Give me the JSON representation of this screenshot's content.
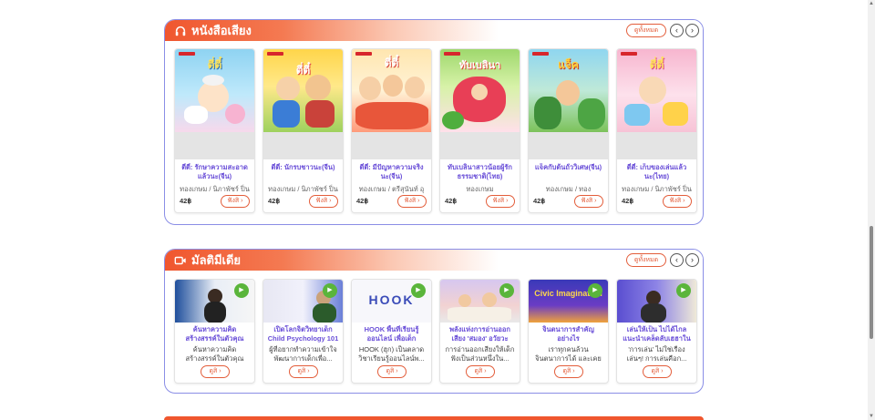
{
  "audiobooks": {
    "title": "หนังสือเสียง",
    "icon": "headphones-icon",
    "view_all": "ดูทั้งหมด",
    "items": [
      {
        "title": "ตี่ตี๋: รักษาความสะอาดแล้วนะ(จีน)",
        "author": "ทองเกษม / นิภาพัชร์ ปิ่น",
        "price": "42฿",
        "button": "ฟังสิ"
      },
      {
        "title": "ตี่ตี๋: นักรบชาวนะ(จีน)",
        "author": "ทองเกษม / นิภาพัชร์ ปิ่น",
        "price": "42฿",
        "button": "ฟังสิ"
      },
      {
        "title": "ตี่ตี๋: มีปัญหาความจริงนะ(จีน)",
        "author": "ทองเกษม / ตรีสุนันท์ อุ",
        "price": "42฿",
        "button": "ฟังสิ"
      },
      {
        "title": "ทับเบลินาสาวน้อยผู้รักธรรมชาติ(ไทย)",
        "author": "ทองเกษม",
        "price": "42฿",
        "button": "ฟังสิ"
      },
      {
        "title": "แจ็คกับต้นถั่ววิเศษ(จีน)",
        "author": "ทองเกษม / ทอง",
        "price": "42฿",
        "button": "ฟังสิ"
      },
      {
        "title": "ตี่ตี๋: เก็บของเล่นแล้วนะ(ไทย)",
        "author": "ทองเกษม / นิภาพัชร์ ปิ่น",
        "price": "42฿",
        "button": "ฟังสิ"
      }
    ]
  },
  "multimedia": {
    "title": "มัลติมีเดีย",
    "icon": "video-camera-icon",
    "view_all": "ดูทั้งหมด",
    "items": [
      {
        "title": "ค้นหาความคิดสร้างสรรค์ในตัวคุณ",
        "desc": "ค้นหาความคิดสร้างสรรค์ในตัวคุณ หากไม่รอ...",
        "button": "ดูสิ"
      },
      {
        "title": "เปิดโลกจิตวิทยาเด็ก Child Psychology 101",
        "desc": "ผู้ที่อยากทำความเข้าใจพัฒนาการเด็กเพื่อ...",
        "button": "ดูสิ"
      },
      {
        "title": "HOOK พื้นที่เรียนรู้ออนไลน์ เพื่อเด็ก",
        "desc": "HOOK (ฮุก) เป็นตลาดวิชาเรียนรู้ออนไลน์พ...",
        "button": "ดูสิ"
      },
      {
        "title": "พลังแห่งการอ่านออกเสียง 'สมอง' อวัยวะ",
        "desc": "การอ่านออกเสียงให้เด็กฟังเป็นส่วนหนึ่งใน...",
        "button": "ดูสิ"
      },
      {
        "title": "จินตนาการสำคัญอย่างไร",
        "desc": "เราทุกคนล้วนจินตนาการได้ และเคยใช้จินตนา...",
        "button": "ดูสิ"
      },
      {
        "title": "เล่นให้เป็น ไปได้ไกล แนะนำเคล็ดลับเฮฮาในบ้าน!",
        "desc": "'การเล่น' ไม่ใช่เรื่องเล่นๆ! การเล่นคือก...",
        "button": "ดูสิ"
      }
    ]
  },
  "media_thumb_texts": [
    "Civic Imagination",
    "HOOK"
  ],
  "colors": {
    "accent": "#f0562e",
    "title_purple": "#6a4fd8",
    "border": "#8a8ee6",
    "tag_green": "#5ab53b"
  }
}
